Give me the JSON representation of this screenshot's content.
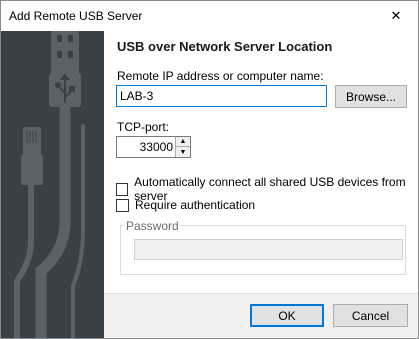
{
  "window": {
    "title": "Add Remote USB Server",
    "close_glyph": "✕"
  },
  "icons": {
    "close": "close-icon",
    "side_art": "usb-cable-graphic",
    "spin_up": "spin-up-icon",
    "spin_down": "spin-down-icon"
  },
  "main": {
    "heading": "USB over Network Server Location",
    "ip_label": "Remote IP address or computer name:",
    "ip_value": "LAB-3",
    "browse_label": "Browse...",
    "port_label": "TCP-port:",
    "port_value": "33000",
    "auto_connect_label": "Automatically connect all shared USB devices from server",
    "auto_connect_checked": false,
    "require_auth_label": "Require authentication",
    "require_auth_checked": false,
    "password_group_label": "Password",
    "password_value": ""
  },
  "footer": {
    "ok_label": "OK",
    "cancel_label": "Cancel"
  },
  "colors": {
    "side_panel": "#3a4146",
    "graphic": "#5a6268",
    "focus_accent": "#0078d7",
    "button_face": "#e1e1e1"
  }
}
